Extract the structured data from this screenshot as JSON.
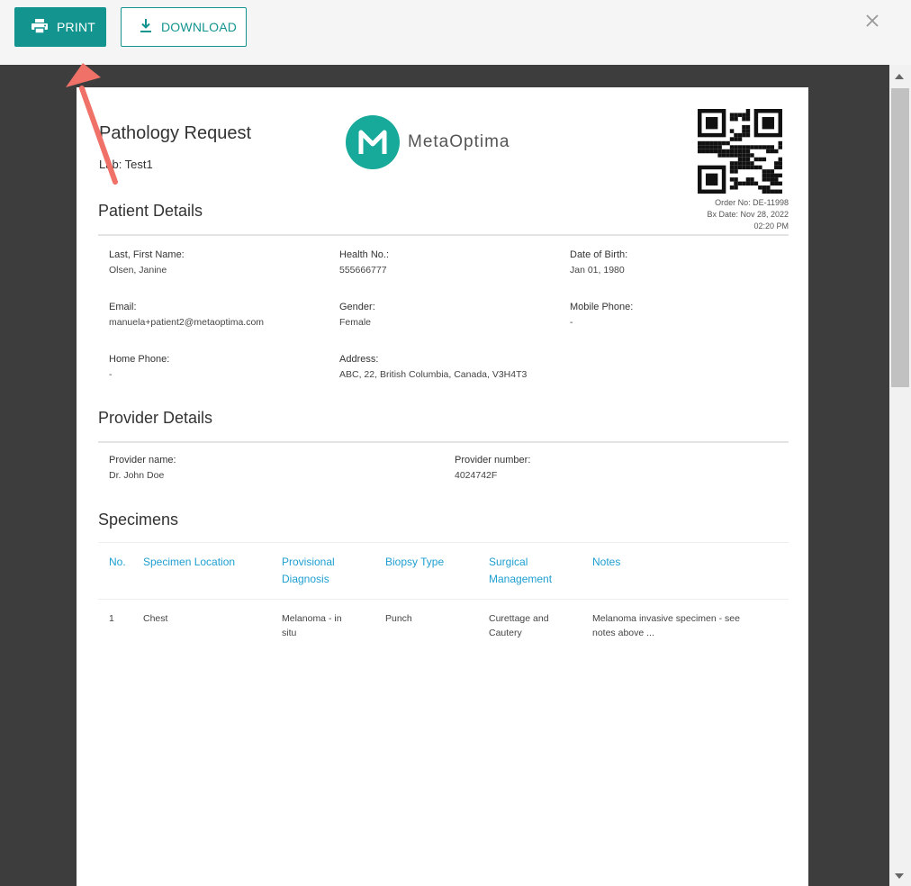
{
  "toolbar": {
    "print_label": "PRINT",
    "download_label": "DOWNLOAD"
  },
  "document": {
    "title": "Pathology Request",
    "lab": "Lab: Test1",
    "logo_text": "MetaOptima",
    "order_no": "Order No: DE-11998",
    "bx_date": "Bx Date: Nov 28, 2022",
    "bx_time": "02:20 PM",
    "patient": {
      "heading": "Patient Details",
      "fields": [
        {
          "label": "Last, First Name:",
          "value": "Olsen, Janine"
        },
        {
          "label": "Health No.:",
          "value": "555666777"
        },
        {
          "label": "Date of Birth:",
          "value": "Jan 01, 1980"
        },
        {
          "label": "Email:",
          "value": "manuela+patient2@metaoptima.com"
        },
        {
          "label": "Gender:",
          "value": "Female"
        },
        {
          "label": "Mobile Phone:",
          "value": "-"
        },
        {
          "label": "Home Phone:",
          "value": "-"
        },
        {
          "label": "Address:",
          "value": "ABC, 22, British Columbia, Canada, V3H4T3"
        }
      ]
    },
    "provider": {
      "heading": "Provider Details",
      "fields": [
        {
          "label": "Provider name:",
          "value": "Dr. John Doe"
        },
        {
          "label": "Provider number:",
          "value": "4024742F"
        }
      ]
    },
    "specimens": {
      "heading": "Specimens",
      "columns": [
        "No.",
        "Specimen Location",
        "Provisional\nDiagnosis",
        "Biopsy Type",
        "Surgical\nManagement",
        "Notes"
      ],
      "rows": [
        [
          "1",
          "Chest",
          "Melanoma - in\nsitu",
          "Punch",
          "Curettage and\nCautery",
          "Melanoma invasive specimen - see\nnotes above ..."
        ]
      ]
    }
  },
  "colors": {
    "accent": "#13948f",
    "table_header": "#1e9fd0",
    "arrow": "#f07167",
    "viewer_bg": "#3d3d3d"
  },
  "icons": {
    "print": "printer-icon",
    "download": "download-icon",
    "close": "close-icon"
  }
}
